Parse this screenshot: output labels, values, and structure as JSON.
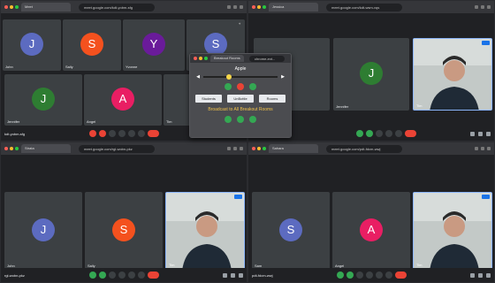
{
  "colors": {
    "muted_red": "#ea4335",
    "green": "#34a853",
    "accent_blue": "#1a73e8",
    "broadcast_yellow": "#f1c24a"
  },
  "windows": {
    "top_left": {
      "tab": "Meet",
      "url": "meet.google.com/kdt-yobm-sfg",
      "code": "kdt-yobm-sfg",
      "tiles": [
        {
          "letter": "J",
          "name": "John",
          "color": "#5c6bc0"
        },
        {
          "letter": "S",
          "name": "Sally",
          "color": "#f4511e"
        },
        {
          "letter": "Y",
          "name": "Yvonne",
          "color": "#6a1b9a"
        },
        {
          "letter": "S",
          "name": "",
          "color": "#5c6bc0"
        },
        {
          "letter": "J",
          "name": "Jennifer",
          "color": "#2e7d32"
        },
        {
          "letter": "A",
          "name": "Angel",
          "color": "#e91e63"
        },
        {
          "letter": "",
          "name": "Tim"
        }
      ]
    },
    "top_right": {
      "tab": "Jessica",
      "url": "meet.google.com/kdt-wsm-vqs",
      "code": "",
      "tiles": [
        {
          "letter": "J",
          "name": "Jennifer",
          "color": "#2e7d32"
        }
      ],
      "self_name": "Tim"
    },
    "bottom_left": {
      "tab": "Strata",
      "url": "meet.google.com/rgl-wobn-pkz",
      "code": "rgl-wobn-pkz",
      "tiles": [
        {
          "letter": "J",
          "name": "John",
          "color": "#5c6bc0"
        },
        {
          "letter": "S",
          "name": "Sally",
          "color": "#f4511e"
        }
      ],
      "self_name": "Tim"
    },
    "bottom_right": {
      "tab": "Sahara",
      "url": "meet.google.com/pdt-fdcm-wwj",
      "code": "pdt-fdcm-wwj",
      "tiles": [
        {
          "letter": "S",
          "name": "Sam",
          "color": "#5c6bc0"
        },
        {
          "letter": "A",
          "name": "Angel",
          "color": "#e91e63"
        }
      ],
      "self_name": "Tim"
    }
  },
  "popup": {
    "tab": "Breakout Rooms",
    "url": "chrome-ext...",
    "title": "Apple",
    "slider_value": 0.35,
    "buttons": {
      "students": "Students",
      "unbottle": "UnBottle",
      "rooms": "Rooms"
    },
    "broadcast": "Broadcast to All Breakout Rooms"
  }
}
